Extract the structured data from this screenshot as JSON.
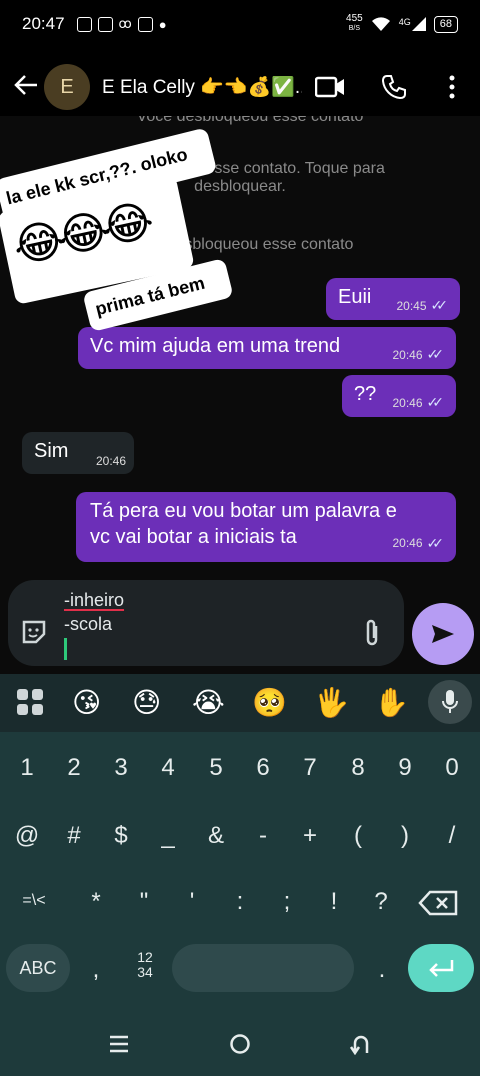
{
  "status_bar": {
    "time": "20:47",
    "net_speed_top": "455",
    "net_speed_bottom": "B/S",
    "network": "4G",
    "battery": "68"
  },
  "header": {
    "avatar_letter": "E",
    "contact_name": "E Ela Celly 👉👈💰✅..."
  },
  "chat": {
    "system_1": "Você desbloqueou esse contato",
    "system_2_line1": "Você bloqueou esse contato. Toque para",
    "system_2_line2": "desbloquear.",
    "system_3": "Você desbloqueou esse contato",
    "messages": [
      {
        "text": "Euii",
        "time": "20:45"
      },
      {
        "text": "Vc mim ajuda em uma trend",
        "time": "20:46"
      },
      {
        "text": "??",
        "time": "20:46"
      },
      {
        "text": "Sim",
        "time": "20:46"
      },
      {
        "text_line1": "Tá pera eu vou botar um palavra e",
        "text_line2": "vc vai botar a iniciais ta",
        "time": "20:46"
      }
    ]
  },
  "sticker": {
    "line1": "la ele kk scr,??. oloko",
    "emojis": "😂😂😂",
    "line2": "prima tá bem"
  },
  "composer": {
    "line1": "-inheiro",
    "line2": "-scola"
  },
  "keyboard": {
    "emoji_row": [
      "😘",
      "😓",
      "😭",
      "🥺",
      "🖐",
      "✋"
    ],
    "row1": [
      "1",
      "2",
      "3",
      "4",
      "5",
      "6",
      "7",
      "8",
      "9",
      "0"
    ],
    "row2": [
      "@",
      "#",
      "$",
      "_",
      "&",
      "-",
      "+",
      "(",
      ")",
      "/"
    ],
    "row3": [
      "=\\<",
      "*",
      "\"",
      "'",
      ":",
      ";",
      "!",
      "?"
    ],
    "abc": "ABC",
    "comma": ",",
    "num_top": "12",
    "num_bottom": "34",
    "period": "."
  },
  "colors": {
    "outgoing_bubble": "#6c2fb8",
    "incoming_bubble": "#1f2528",
    "send_button": "#b69cf3",
    "keyboard_bg": "#1e3a3b",
    "enter_key": "#5ed8c4"
  }
}
